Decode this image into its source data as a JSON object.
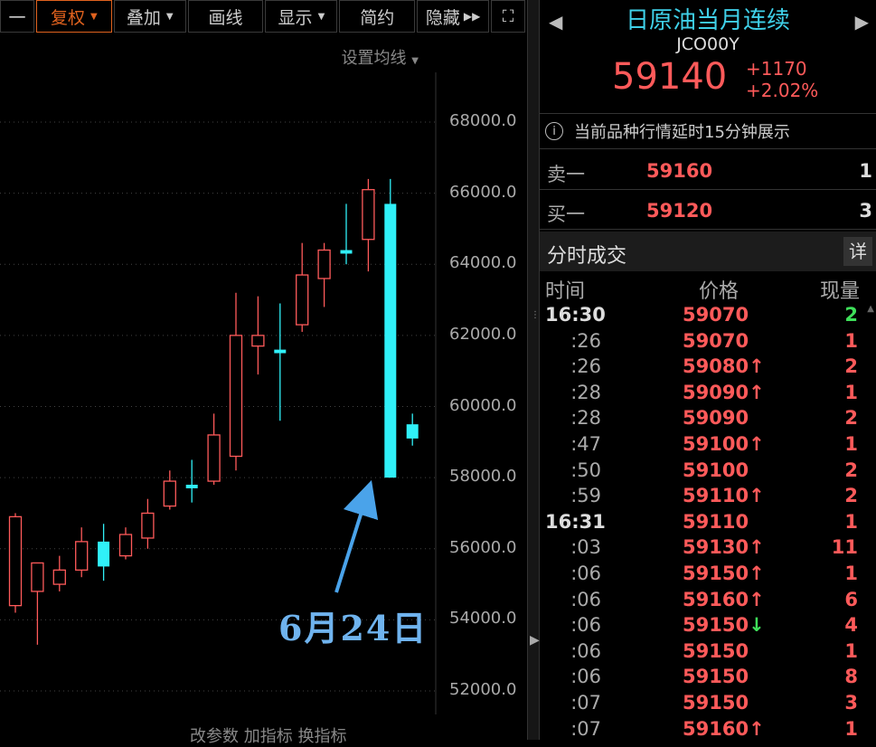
{
  "toolbar": {
    "btn0": "一",
    "btn1": "复权",
    "btn2": "叠加",
    "btn3": "画线",
    "btn4": "显示",
    "btn5": "简约",
    "btn6": "隐藏"
  },
  "chart": {
    "set_ma_label": "设置均线",
    "annotation": "6月24日",
    "bottom_labels": "改参数  加指标  换指标"
  },
  "chart_data": {
    "type": "candlestick",
    "ylim": [
      51000,
      70500
    ],
    "yticks": [
      "68000.0",
      "66000.0",
      "64000.0",
      "62000.0",
      "60000.0",
      "58000.0",
      "56000.0",
      "54000.0",
      "52000.0"
    ],
    "candles": [
      {
        "o": 54400,
        "c": 56900,
        "h": 57000,
        "l": 54200
      },
      {
        "o": 54800,
        "c": 55600,
        "h": 55600,
        "l": 53300
      },
      {
        "o": 55000,
        "c": 55400,
        "h": 55800,
        "l": 54800
      },
      {
        "o": 55400,
        "c": 56200,
        "h": 56600,
        "l": 55200
      },
      {
        "o": 56200,
        "c": 55500,
        "h": 56700,
        "l": 55100
      },
      {
        "o": 55800,
        "c": 56400,
        "h": 56600,
        "l": 55700
      },
      {
        "o": 56300,
        "c": 57000,
        "h": 57400,
        "l": 56000
      },
      {
        "o": 57200,
        "c": 57900,
        "h": 58200,
        "l": 57100
      },
      {
        "o": 57800,
        "c": 57700,
        "h": 58500,
        "l": 57300
      },
      {
        "o": 57900,
        "c": 59200,
        "h": 59800,
        "l": 57800
      },
      {
        "o": 58600,
        "c": 62000,
        "h": 63200,
        "l": 58200
      },
      {
        "o": 61700,
        "c": 62000,
        "h": 63100,
        "l": 60900
      },
      {
        "o": 61600,
        "c": 61500,
        "h": 62900,
        "l": 59600
      },
      {
        "o": 62300,
        "c": 63700,
        "h": 64600,
        "l": 62100
      },
      {
        "o": 63600,
        "c": 64400,
        "h": 64600,
        "l": 62800
      },
      {
        "o": 64400,
        "c": 64300,
        "h": 65700,
        "l": 64000
      },
      {
        "o": 64700,
        "c": 66100,
        "h": 66400,
        "l": 63800
      },
      {
        "o": 65700,
        "c": 58000,
        "h": 66400,
        "l": 58000
      },
      {
        "o": 59500,
        "c": 59100,
        "h": 59800,
        "l": 58900
      }
    ],
    "colors": {
      "up": "#ff5a5a",
      "down": "#30f0f8"
    }
  },
  "quote": {
    "name": "日原油当月连续",
    "code": "JCO00Y",
    "price": "59140",
    "change": "+1170",
    "change_pct": "+2.02%",
    "notice": "当前品种行情延时15分钟展示",
    "sell_label": "卖一",
    "sell_price": "59160",
    "sell_vol": "1",
    "buy_label": "买一",
    "buy_price": "59120",
    "buy_vol": "3",
    "ticks_title": "分时成交",
    "detail_btn": "详",
    "col_time": "时间",
    "col_price": "价格",
    "col_vol": "现量"
  },
  "ticks": [
    {
      "time": "16:30",
      "price": "59070",
      "arrow": "",
      "vol": "2",
      "vol_color": "#3ee05a",
      "bold": true
    },
    {
      "time": ":26",
      "price": "59070",
      "arrow": "",
      "vol": "1",
      "vol_color": "#ff5a5a"
    },
    {
      "time": ":26",
      "price": "59080",
      "arrow": "up",
      "vol": "2",
      "vol_color": "#ff5a5a"
    },
    {
      "time": ":28",
      "price": "59090",
      "arrow": "up",
      "vol": "1",
      "vol_color": "#ff5a5a"
    },
    {
      "time": ":28",
      "price": "59090",
      "arrow": "",
      "vol": "2",
      "vol_color": "#ff5a5a"
    },
    {
      "time": ":47",
      "price": "59100",
      "arrow": "up",
      "vol": "1",
      "vol_color": "#ff5a5a"
    },
    {
      "time": ":50",
      "price": "59100",
      "arrow": "",
      "vol": "2",
      "vol_color": "#ff5a5a"
    },
    {
      "time": ":59",
      "price": "59110",
      "arrow": "up",
      "vol": "2",
      "vol_color": "#ff5a5a"
    },
    {
      "time": "16:31",
      "price": "59110",
      "arrow": "",
      "vol": "1",
      "vol_color": "#ff5a5a",
      "bold": true
    },
    {
      "time": ":03",
      "price": "59130",
      "arrow": "up",
      "vol": "11",
      "vol_color": "#ff5a5a"
    },
    {
      "time": ":06",
      "price": "59150",
      "arrow": "up",
      "vol": "1",
      "vol_color": "#ff5a5a"
    },
    {
      "time": ":06",
      "price": "59160",
      "arrow": "up",
      "vol": "6",
      "vol_color": "#ff5a5a"
    },
    {
      "time": ":06",
      "price": "59150",
      "arrow": "down",
      "vol": "4",
      "vol_color": "#ff5a5a"
    },
    {
      "time": ":06",
      "price": "59150",
      "arrow": "",
      "vol": "1",
      "vol_color": "#ff5a5a"
    },
    {
      "time": ":06",
      "price": "59150",
      "arrow": "",
      "vol": "8",
      "vol_color": "#ff5a5a"
    },
    {
      "time": ":07",
      "price": "59150",
      "arrow": "",
      "vol": "3",
      "vol_color": "#ff5a5a"
    },
    {
      "time": ":07",
      "price": "59160",
      "arrow": "up",
      "vol": "1",
      "vol_color": "#ff5a5a"
    }
  ]
}
